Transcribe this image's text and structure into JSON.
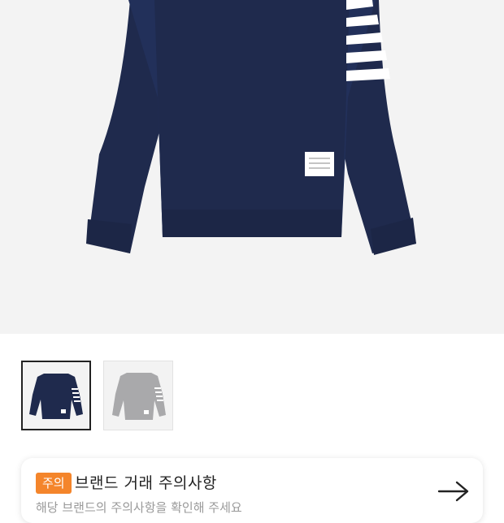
{
  "product": {
    "main_image": "navy-sweatshirt-with-white-sleeve-stripes",
    "thumbnails": [
      {
        "name": "navy-sweatshirt-thumbnail",
        "color": "#1f2a4d",
        "selected": true
      },
      {
        "name": "gray-sweatshirt-thumbnail",
        "color": "#a9a9ab",
        "selected": false
      }
    ]
  },
  "notice": {
    "badge": "주의",
    "title": "브랜드 거래 주의사항",
    "subtitle": "해당 브랜드의 주의사항을 확인해 주세요",
    "arrow_icon": "arrow-right-icon"
  },
  "colors": {
    "badge": "#f4852b",
    "hero_bg": "#f3f3f3",
    "navy": "#1f2a4d"
  }
}
